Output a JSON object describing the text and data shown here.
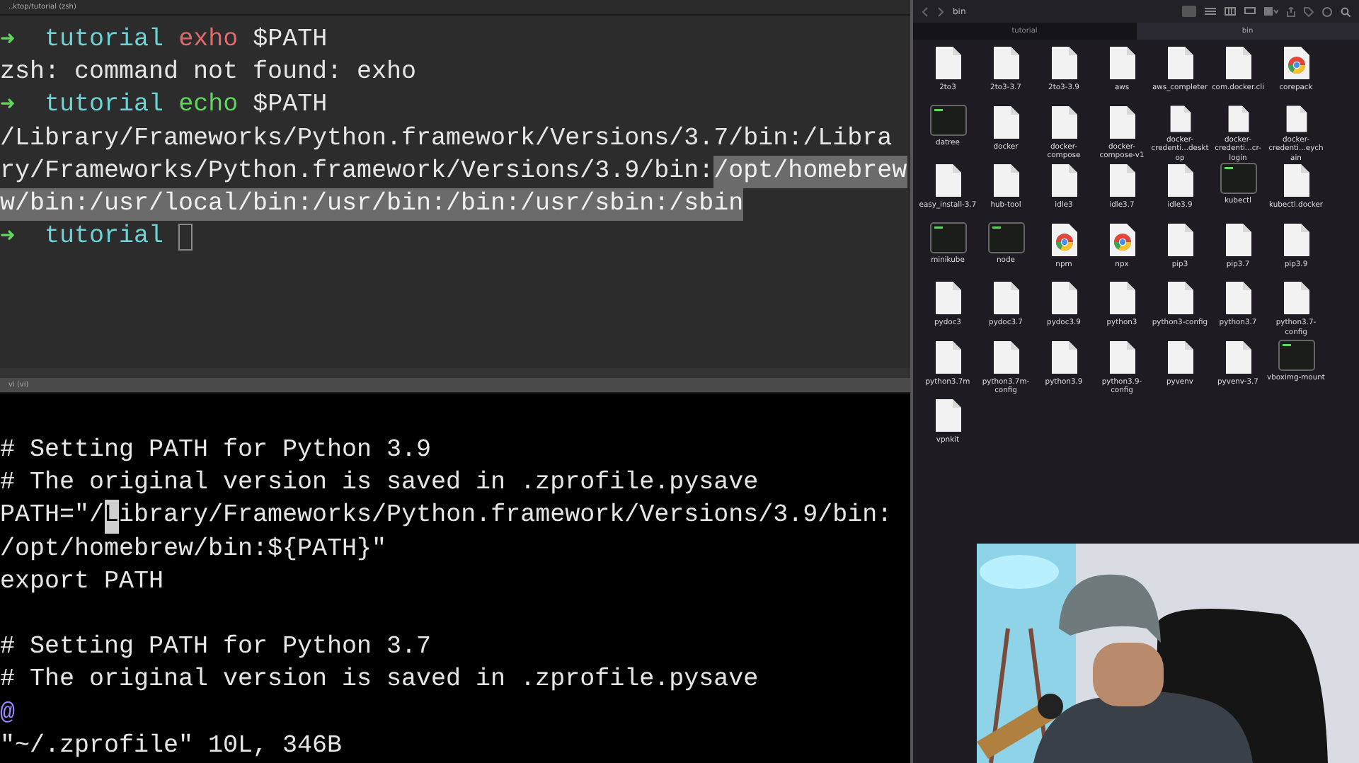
{
  "terminal": {
    "title": "..ktop/tutorial (zsh)",
    "lines": [
      {
        "cursor": false,
        "segments": [
          {
            "text": "➜",
            "kind": "arrow",
            "selected": false
          },
          {
            "text": "  tutorial",
            "kind": "dir",
            "selected": false
          },
          {
            "text": " exho",
            "kind": "bad_cmd",
            "selected": false
          },
          {
            "text": " $PATH",
            "kind": "plain",
            "selected": false
          }
        ]
      },
      {
        "cursor": false,
        "segments": [
          {
            "text": "zsh: command not found: exho",
            "kind": "plain",
            "selected": false
          }
        ]
      },
      {
        "cursor": false,
        "segments": [
          {
            "text": "➜",
            "kind": "arrow",
            "selected": false
          },
          {
            "text": "  tutorial",
            "kind": "dir",
            "selected": false
          },
          {
            "text": " echo",
            "kind": "cmd",
            "selected": false
          },
          {
            "text": " $PATH",
            "kind": "plain",
            "selected": false
          }
        ]
      },
      {
        "cursor": false,
        "segments": [
          {
            "text": "/Library/Frameworks/Python.framework/Versions/3.7/bin:/Libra",
            "kind": "plain",
            "selected": false
          }
        ]
      },
      {
        "cursor": false,
        "segments": [
          {
            "text": "ry/Frameworks/Python.framework/Versions/3.9/bin:",
            "kind": "plain",
            "selected": false
          },
          {
            "text": "/opt/homebrew",
            "kind": "plain",
            "selected": true
          }
        ]
      },
      {
        "cursor": false,
        "segments": [
          {
            "text": "w/bin:/usr/local/bin:/usr/bin:/bin:/usr/sbin:/sbin",
            "kind": "plain",
            "selected": true
          }
        ]
      },
      {
        "cursor": true,
        "segments": [
          {
            "text": "➜",
            "kind": "arrow",
            "selected": false
          },
          {
            "text": "  tutorial",
            "kind": "dir",
            "selected": false
          }
        ]
      }
    ]
  },
  "editor": {
    "title": "vi (vi)",
    "blocks": [
      {
        "lines": [
          {
            "segments": [
              {
                "text": "# Setting PATH for Python 3.9",
                "kind": "plain"
              }
            ]
          },
          {
            "segments": [
              {
                "text": "# The original version is saved in .zprofile.pysave",
                "kind": "plain"
              }
            ]
          },
          {
            "segments": [
              {
                "text": "PATH=\"/",
                "kind": "plain"
              },
              {
                "text": "L",
                "kind": "cursor"
              },
              {
                "text": "ibrary/Frameworks/Python.framework/Versions/3.9/bin:",
                "kind": "plain"
              }
            ]
          },
          {
            "segments": [
              {
                "text": "/opt/homebrew/bin:${PATH}\"",
                "kind": "plain"
              }
            ]
          },
          {
            "segments": [
              {
                "text": "export PATH",
                "kind": "plain"
              }
            ]
          }
        ]
      },
      {
        "lines": [
          {
            "segments": [
              {
                "text": "# Setting PATH for Python 3.7",
                "kind": "plain"
              }
            ]
          },
          {
            "segments": [
              {
                "text": "# The original version is saved in .zprofile.pysave",
                "kind": "plain"
              }
            ]
          },
          {
            "segments": [
              {
                "text": "@",
                "kind": "marker"
              }
            ]
          },
          {
            "segments": [
              {
                "text": "\"~/.zprofile\" 10L, 346B",
                "kind": "plain"
              }
            ]
          }
        ]
      }
    ]
  },
  "finder": {
    "title": "bin",
    "tabs": [
      {
        "label": "tutorial",
        "selected": false
      },
      {
        "label": "bin",
        "selected": true
      }
    ],
    "items": [
      {
        "name": "2to3",
        "kind": "doc"
      },
      {
        "name": "2to3-3.7",
        "kind": "doc"
      },
      {
        "name": "2to3-3.9",
        "kind": "doc"
      },
      {
        "name": "aws",
        "kind": "doc"
      },
      {
        "name": "aws_completer",
        "kind": "doc"
      },
      {
        "name": "com.docker.cli",
        "kind": "doc"
      },
      {
        "name": "corepack",
        "kind": "round"
      },
      {
        "name": "datree",
        "kind": "exec"
      },
      {
        "name": "docker",
        "kind": "doc"
      },
      {
        "name": "docker-compose",
        "kind": "doc"
      },
      {
        "name": "docker-compose-v1",
        "kind": "doc"
      },
      {
        "name": "docker-credenti...desktop",
        "kind": "doc"
      },
      {
        "name": "docker-credenti...cr-login",
        "kind": "doc"
      },
      {
        "name": "docker-credenti...eychain",
        "kind": "doc"
      },
      {
        "name": "easy_install-3.7",
        "kind": "doc"
      },
      {
        "name": "hub-tool",
        "kind": "doc"
      },
      {
        "name": "idle3",
        "kind": "doc"
      },
      {
        "name": "idle3.7",
        "kind": "doc"
      },
      {
        "name": "idle3.9",
        "kind": "doc"
      },
      {
        "name": "kubectl",
        "kind": "exec"
      },
      {
        "name": "kubectl.docker",
        "kind": "doc"
      },
      {
        "name": "minikube",
        "kind": "exec"
      },
      {
        "name": "node",
        "kind": "exec"
      },
      {
        "name": "npm",
        "kind": "round"
      },
      {
        "name": "npx",
        "kind": "round"
      },
      {
        "name": "pip3",
        "kind": "doc"
      },
      {
        "name": "pip3.7",
        "kind": "doc"
      },
      {
        "name": "pip3.9",
        "kind": "doc"
      },
      {
        "name": "pydoc3",
        "kind": "doc"
      },
      {
        "name": "pydoc3.7",
        "kind": "doc"
      },
      {
        "name": "pydoc3.9",
        "kind": "doc"
      },
      {
        "name": "python3",
        "kind": "doc"
      },
      {
        "name": "python3-config",
        "kind": "doc"
      },
      {
        "name": "python3.7",
        "kind": "doc"
      },
      {
        "name": "python3.7-config",
        "kind": "doc"
      },
      {
        "name": "python3.7m",
        "kind": "doc"
      },
      {
        "name": "python3.7m-config",
        "kind": "doc"
      },
      {
        "name": "python3.9",
        "kind": "doc"
      },
      {
        "name": "python3.9-config",
        "kind": "doc"
      },
      {
        "name": "pyvenv",
        "kind": "doc"
      },
      {
        "name": "pyvenv-3.7",
        "kind": "doc"
      },
      {
        "name": "vboximg-mount",
        "kind": "exec"
      },
      {
        "name": "vpnkit",
        "kind": "doc"
      }
    ]
  }
}
